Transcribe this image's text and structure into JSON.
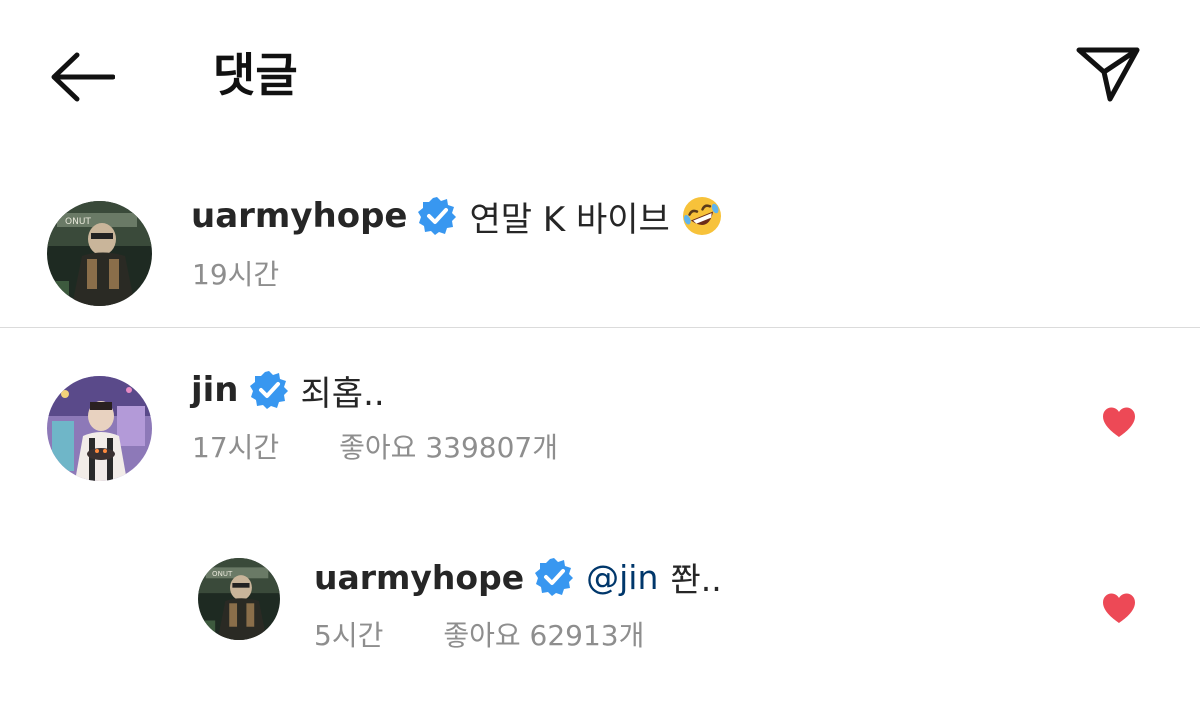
{
  "header": {
    "title": "댓글",
    "back_icon": "arrow-left-icon",
    "send_icon": "paper-plane-icon"
  },
  "caption": {
    "username": "uarmyhope",
    "text": "연말 K 바이브",
    "emoji": "rolling-on-floor-laughing-icon",
    "time": "19시간"
  },
  "comments": [
    {
      "username": "jin",
      "text": "죄홉..",
      "time": "17시간",
      "likes": "좋아요 339807개",
      "liked": true
    }
  ],
  "reply": {
    "username": "uarmyhope",
    "mention": "@jin",
    "text": "쫜..",
    "time": "5시간",
    "likes": "좋아요 62913개",
    "liked": true
  },
  "colors": {
    "verified": "#3897f0",
    "heart": "#ed4956",
    "meta": "#8e8e8e",
    "mention": "#00376b",
    "divider": "#dbdbdb"
  }
}
